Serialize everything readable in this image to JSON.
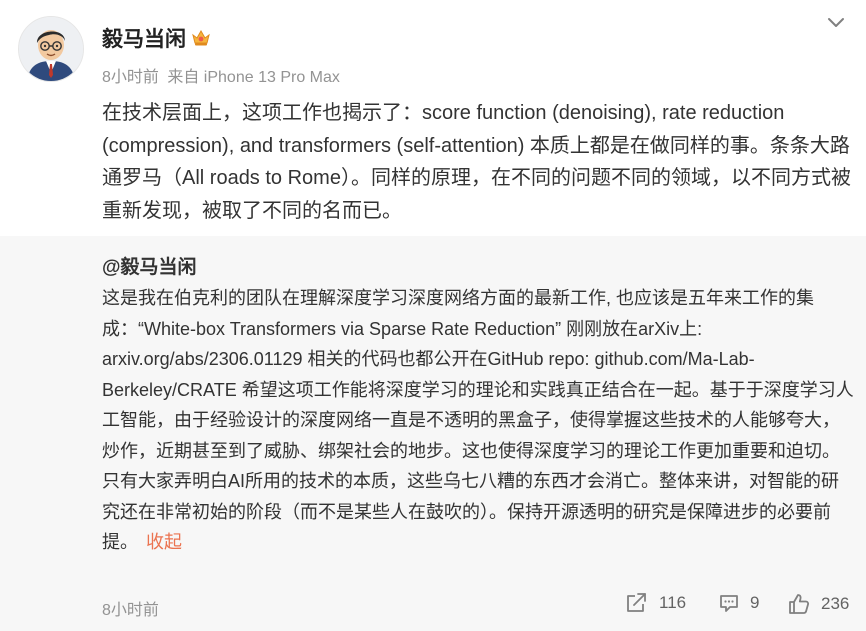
{
  "post": {
    "username": "毅马当闲",
    "time": "8小时前",
    "source": "来自 iPhone 13 Pro Max",
    "text": "在技术层面上，这项工作也揭示了：score function (denoising), rate reduction (compression), and transformers (self-attention) 本质上都是在做同样的事。条条大路通罗马（All roads to Rome）。同样的原理，在不同的问题不同的领域，以不同方式被重新发现，被取了不同的名而已。"
  },
  "repost": {
    "author": "@毅马当闲",
    "text": "这是我在伯克利的团队在理解深度学习深度网络方面的最新工作, 也应该是五年来工作的集成：“White-box Transformers via Sparse Rate Reduction” 刚刚放在arXiv上: arxiv.org/abs/2306.01129 相关的代码也都公开在GitHub repo: github.com/Ma-Lab-Berkeley/CRATE 希望这项工作能将深度学习的理论和实践真正结合在一起。基于于深度学习人工智能，由于经验设计的深度网络一直是不透明的黑盒子，使得掌握这些技术的人能够夸大，炒作，近期甚至到了威胁、绑架社会的地步。这也使得深度学习的理论工作更加重要和迫切。只有大家弄明白AI所用的技术的本质，这些乌七八糟的东西才会消亡。整体来讲，对智能的研究还在非常初始的阶段（而不是某些人在鼓吹的）。保持开源透明的研究是保障进步的必要前提。",
    "collapse_label": "收起",
    "time": "8小时前",
    "actions": {
      "share_count": "116",
      "comment_count": "9",
      "like_count": "236"
    }
  },
  "icons": {
    "vip": "vip-crown-badge-icon",
    "menu": "chevron-down-icon",
    "share": "share-icon",
    "comment": "comment-icon",
    "like": "thumbs-up-icon"
  },
  "colors": {
    "link": "#eb7350",
    "muted": "#939393",
    "repost_bg": "#f7f7f7"
  }
}
